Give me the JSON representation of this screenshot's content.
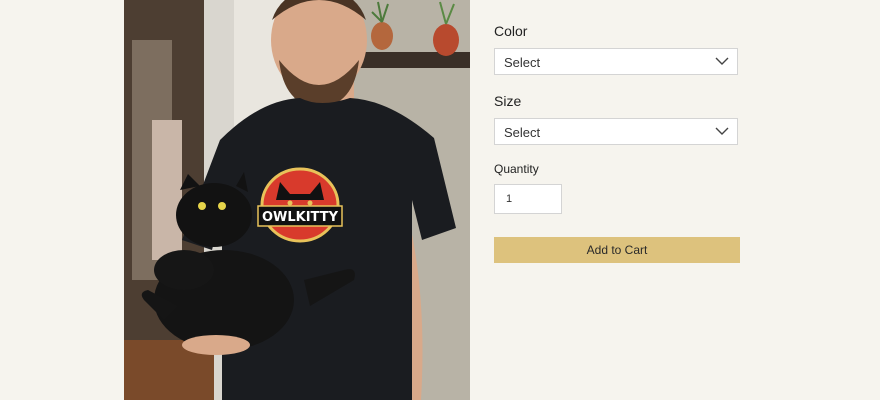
{
  "product": {
    "image_alt": "Man wearing a black OWLKITTY t-shirt holding a black cat",
    "logo_text": "OWLKITTY"
  },
  "options": {
    "color": {
      "label": "Color",
      "value": "Select"
    },
    "size": {
      "label": "Size",
      "value": "Select"
    }
  },
  "quantity": {
    "label": "Quantity",
    "value": "1"
  },
  "cart": {
    "button_label": "Add to Cart"
  },
  "colors": {
    "page_bg": "#f6f4ee",
    "button_bg": "#ddc27d",
    "shirt": "#1a1c20",
    "logo_red": "#d83a2c",
    "logo_gold": "#e8c25a"
  }
}
